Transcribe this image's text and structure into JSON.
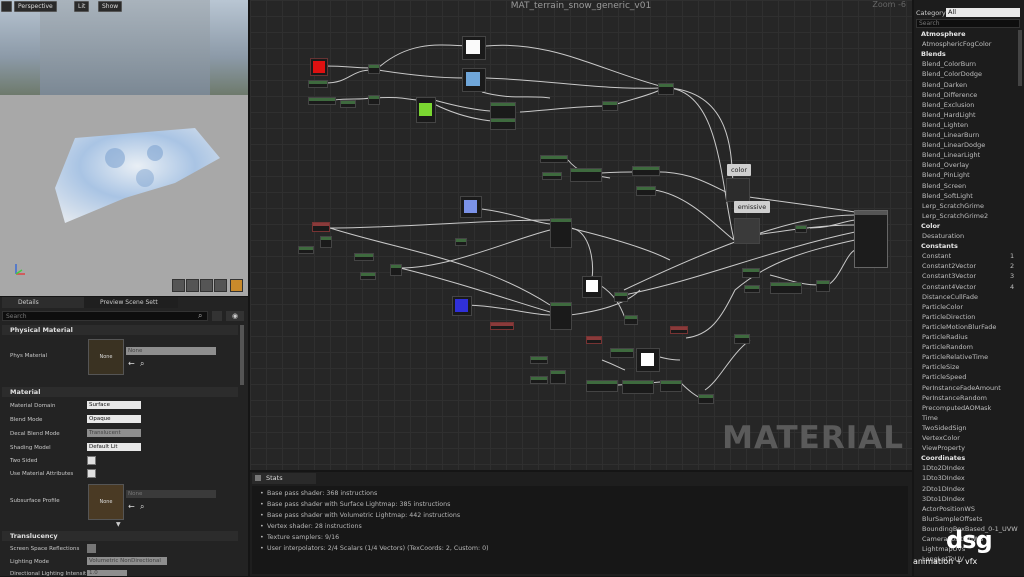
{
  "viewport": {
    "buttons": [
      "Perspective",
      "Lit",
      "Show"
    ]
  },
  "details": {
    "tabs": [
      "Details",
      "Preview Scene Sett"
    ],
    "search_placeholder": "Search",
    "sections": {
      "physical": "Physical Material",
      "material": "Material",
      "translucency": "Translucency"
    },
    "phys_material_label": "Phys Material",
    "phys_material_value": "None",
    "thumb_none": "None",
    "rows": [
      {
        "label": "Material Domain",
        "value": "Surface"
      },
      {
        "label": "Blend Mode",
        "value": "Opaque"
      },
      {
        "label": "Decal Blend Mode",
        "value": "Translucent"
      },
      {
        "label": "Shading Model",
        "value": "Default Lit"
      },
      {
        "label": "Two Sided",
        "value": ""
      },
      {
        "label": "Use Material Attributes",
        "value": ""
      }
    ],
    "subsurface_label": "Subsurface Profile",
    "subsurface_value": "None",
    "translucency_rows": [
      {
        "label": "Screen Space Reflections",
        "value": ""
      },
      {
        "label": "Lighting Mode",
        "value": "Volumetric NonDirectional"
      },
      {
        "label": "Directional Lighting Intensit",
        "value": "1.0"
      }
    ]
  },
  "graph": {
    "title": "MAT_terrain_snow_generic_v01",
    "zoom": "Zoom -6",
    "watermark": "MATERIAL",
    "tooltip_color": "color",
    "tooltip_emissive": "emissive"
  },
  "stats": {
    "tab": "Stats",
    "lines": [
      "Base pass shader: 368 instructions",
      "Base pass shader with Surface Lightmap: 385 instructions",
      "Base pass shader with Volumetric Lightmap: 442 instructions",
      "Vertex shader: 28 instructions",
      "Texture samplers: 9/16",
      "User interpolators: 2/4 Scalars (1/4 Vectors) (TexCoords: 2, Custom: 0)"
    ]
  },
  "palette": {
    "category_label": "Category:",
    "category_value": "All",
    "search_placeholder": "Search",
    "entries": [
      {
        "t": "cat",
        "label": "Atmosphere"
      },
      {
        "t": "item",
        "label": "AtmosphericFogColor"
      },
      {
        "t": "cat",
        "label": "Blends"
      },
      {
        "t": "item",
        "label": "Blend_ColorBurn"
      },
      {
        "t": "item",
        "label": "Blend_ColorDodge"
      },
      {
        "t": "item",
        "label": "Blend_Darken"
      },
      {
        "t": "item",
        "label": "Blend_Difference"
      },
      {
        "t": "item",
        "label": "Blend_Exclusion"
      },
      {
        "t": "item",
        "label": "Blend_HardLight"
      },
      {
        "t": "item",
        "label": "Blend_Lighten"
      },
      {
        "t": "item",
        "label": "Blend_LinearBurn"
      },
      {
        "t": "item",
        "label": "Blend_LinearDodge"
      },
      {
        "t": "item",
        "label": "Blend_LinearLight"
      },
      {
        "t": "item",
        "label": "Blend_Overlay"
      },
      {
        "t": "item",
        "label": "Blend_PinLight"
      },
      {
        "t": "item",
        "label": "Blend_Screen"
      },
      {
        "t": "item",
        "label": "Blend_SoftLight"
      },
      {
        "t": "item",
        "label": "Lerp_ScratchGrime"
      },
      {
        "t": "item",
        "label": "Lerp_ScratchGrime2"
      },
      {
        "t": "cat",
        "label": "Color"
      },
      {
        "t": "item",
        "label": "Desaturation"
      },
      {
        "t": "cat",
        "label": "Constants"
      },
      {
        "t": "item",
        "label": "Constant",
        "key": "1"
      },
      {
        "t": "item",
        "label": "Constant2Vector",
        "key": "2"
      },
      {
        "t": "item",
        "label": "Constant3Vector",
        "key": "3"
      },
      {
        "t": "item",
        "label": "Constant4Vector",
        "key": "4"
      },
      {
        "t": "item",
        "label": "DistanceCullFade"
      },
      {
        "t": "item",
        "label": "ParticleColor"
      },
      {
        "t": "item",
        "label": "ParticleDirection"
      },
      {
        "t": "item",
        "label": "ParticleMotionBlurFade"
      },
      {
        "t": "item",
        "label": "ParticleRadius"
      },
      {
        "t": "item",
        "label": "ParticleRandom"
      },
      {
        "t": "item",
        "label": "ParticleRelativeTime"
      },
      {
        "t": "item",
        "label": "ParticleSize"
      },
      {
        "t": "item",
        "label": "ParticleSpeed"
      },
      {
        "t": "item",
        "label": "PerInstanceFadeAmount"
      },
      {
        "t": "item",
        "label": "PerInstanceRandom"
      },
      {
        "t": "item",
        "label": "PrecomputedAOMask"
      },
      {
        "t": "item",
        "label": "Time"
      },
      {
        "t": "item",
        "label": "TwoSidedSign"
      },
      {
        "t": "item",
        "label": "VertexColor"
      },
      {
        "t": "item",
        "label": "ViewProperty"
      },
      {
        "t": "cat",
        "label": "Coordinates"
      },
      {
        "t": "item",
        "label": "1Dto2DIndex"
      },
      {
        "t": "item",
        "label": "1Dto3DIndex"
      },
      {
        "t": "item",
        "label": "2Dto1DIndex"
      },
      {
        "t": "item",
        "label": "3Dto1DIndex"
      },
      {
        "t": "item",
        "label": "ActorPositionWS"
      },
      {
        "t": "item",
        "label": "BlurSampleOffsets"
      },
      {
        "t": "item",
        "label": "BoundingBoxBased_0-1_UVW"
      },
      {
        "t": "item",
        "label": "CameraPositionWS"
      },
      {
        "t": "item",
        "label": "LightmapUVs"
      },
      {
        "t": "item",
        "label": "LongLatToUV"
      }
    ]
  },
  "branding": {
    "logo": "dsg",
    "tagline": "animation + vfx"
  },
  "colors": {
    "accent": "#f0a030",
    "node_header": "#3e6a3e",
    "graph_bg": "#262626"
  }
}
